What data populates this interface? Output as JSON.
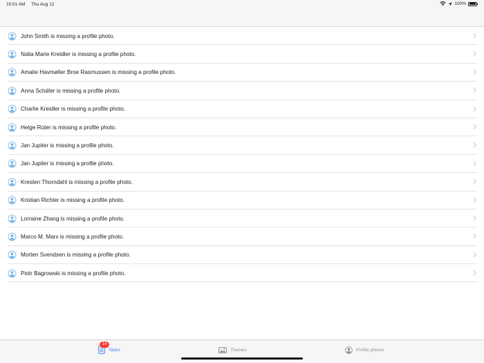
{
  "status_bar": {
    "time": "10:01 AM",
    "date": "Thu Aug 12",
    "battery": "100%",
    "icons": [
      "wifi-icon",
      "location-arrow-icon",
      "battery-icon"
    ]
  },
  "tasks": [
    {
      "text": "John Smith is missing a profile photo."
    },
    {
      "text": "Nalia Marie Kreidler is missing a profile photo."
    },
    {
      "text": "Amalie Havmøller Broe Rasmussen is missing a profile photo."
    },
    {
      "text": "Anna Schäfer is missing a profile photo."
    },
    {
      "text": "Charlie Kreidler is missing a profile photo."
    },
    {
      "text": "Helge Rüter is missing a profile photo."
    },
    {
      "text": "Jan Jupiter is missing a profile photo."
    },
    {
      "text": "Jan Jupiter is missing a profile photo."
    },
    {
      "text": "Kresten Thorndahl is missing a profile photo."
    },
    {
      "text": "Kristian Richter is missing a profile photo."
    },
    {
      "text": "Lorraine Zhang is missing a profile photo."
    },
    {
      "text": "Marco M. Marx is missing a profile photo."
    },
    {
      "text": "Morten Svendsen is missing a profile photo."
    },
    {
      "text": "Piotr Bagrowski is missing a profile photo."
    }
  ],
  "tab_bar": {
    "tasks": {
      "label": "Tasks",
      "badge": "14",
      "icon": "tasks-list-icon",
      "active": true
    },
    "themes": {
      "label": "Themes",
      "icon": "image-icon",
      "active": false
    },
    "profile_photos": {
      "label": "Profile photos",
      "icon": "user-circle-icon",
      "active": false
    }
  },
  "colors": {
    "accent": "#3b82f6",
    "avatar": "#7db8e8",
    "badge": "#ff3b30",
    "inactive": "#8e8e93"
  }
}
